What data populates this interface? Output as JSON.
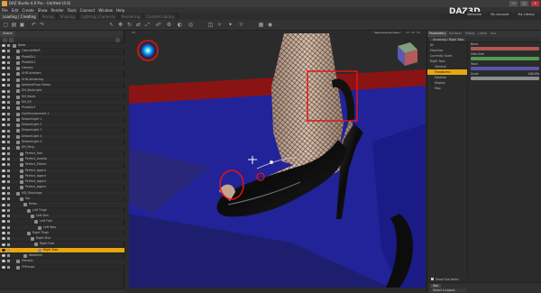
{
  "window": {
    "title": "DAZ Studio 4.6 Pro - Untitled (4.6)",
    "buttons": [
      "—",
      "□",
      "✕"
    ]
  },
  "menu": [
    "File",
    "Edit",
    "Create",
    "Show",
    "Render",
    "Tools",
    "Connect",
    "Window",
    "Help"
  ],
  "brand": {
    "logo_text": "DAZ",
    "logo_suffix": "3D",
    "account_links": [
      "Welcome",
      "My Account",
      "My Library"
    ]
  },
  "workspace_tabs": [
    {
      "label": "Loading | Creating",
      "active": true
    },
    {
      "label": "Posing",
      "active": false
    },
    {
      "label": "Shaping",
      "active": false
    },
    {
      "label": "Lighting | Cameras",
      "active": false
    },
    {
      "label": "Rendering",
      "active": false
    },
    {
      "label": "Content Library",
      "active": false
    }
  ],
  "left_panel": {
    "tabs": [
      "Scene"
    ],
    "tree": [
      {
        "label": "Node",
        "indent": 0,
        "selected": false
      },
      {
        "label": "CapsuleMinR",
        "indent": 1,
        "selected": false
      },
      {
        "label": "PhotoDL1",
        "indent": 1,
        "selected": false
      },
      {
        "label": "PhotoDL2",
        "indent": 1,
        "selected": false
      },
      {
        "label": "Camera",
        "indent": 1,
        "selected": false
      },
      {
        "label": "UHD-Ambient",
        "indent": 1,
        "selected": false
      },
      {
        "label": "UHD-Aerobring",
        "indent": 1,
        "selected": false
      },
      {
        "label": "AmbientFloor Dome",
        "indent": 1,
        "selected": false
      },
      {
        "label": "DH_BackLight",
        "indent": 1,
        "selected": false
      },
      {
        "label": "DH_BackL",
        "indent": 1,
        "selected": false
      },
      {
        "label": "DH_Fill",
        "indent": 1,
        "selected": false
      },
      {
        "label": "PhotoDL3",
        "indent": 1,
        "selected": false
      },
      {
        "label": "UserEnvironment 1",
        "indent": 1,
        "selected": false
      },
      {
        "label": "DistantLight 1",
        "indent": 1,
        "selected": false
      },
      {
        "label": "DistantLight 2",
        "indent": 1,
        "selected": false
      },
      {
        "label": "DistantLight 3",
        "indent": 1,
        "selected": false
      },
      {
        "label": "DistantLight 4",
        "indent": 1,
        "selected": false
      },
      {
        "label": "DistantLight 5",
        "indent": 1,
        "selected": false
      },
      {
        "label": "DH_Ring",
        "indent": 1,
        "selected": false
      },
      {
        "label": "Perfect_Hair",
        "indent": 2,
        "selected": false
      },
      {
        "label": "Perfect_Aurelia",
        "indent": 2,
        "selected": false
      },
      {
        "label": "Perfect_Eillene",
        "indent": 2,
        "selected": false
      },
      {
        "label": "Perfect_Isgard",
        "indent": 2,
        "selected": false
      },
      {
        "label": "Perfect_Isgard",
        "indent": 2,
        "selected": false
      },
      {
        "label": "Perfect_Isgard",
        "indent": 2,
        "selected": false
      },
      {
        "label": "Perfect_Isgard",
        "indent": 2,
        "selected": false
      },
      {
        "label": "ViD_Stockings",
        "indent": 1,
        "selected": false
      },
      {
        "label": "Hip",
        "indent": 2,
        "selected": false
      },
      {
        "label": "Pelvis",
        "indent": 3,
        "selected": false
      },
      {
        "label": "Left Thigh",
        "indent": 4,
        "selected": false
      },
      {
        "label": "Left Shin",
        "indent": 5,
        "selected": false
      },
      {
        "label": "Left Foot",
        "indent": 6,
        "selected": false
      },
      {
        "label": "Left Toes",
        "indent": 7,
        "selected": false
      },
      {
        "label": "Right Thigh",
        "indent": 4,
        "selected": false
      },
      {
        "label": "Right Shin",
        "indent": 5,
        "selected": false
      },
      {
        "label": "Right Foot",
        "indent": 6,
        "selected": false
      },
      {
        "label": "Right Toes",
        "indent": 7,
        "selected": true
      },
      {
        "label": "Abdomen",
        "indent": 3,
        "selected": false
      },
      {
        "label": "Genesis",
        "indent": 1,
        "selected": false
      },
      {
        "label": "FFPumps",
        "indent": 1,
        "selected": false
      }
    ]
  },
  "viewport": {
    "camera_select": "Perspective View",
    "stage_colors": {
      "floor": "#1e2494",
      "red_stripe": "#8a1414",
      "backdrop": "#2b2b2b"
    }
  },
  "right_panel": {
    "tabs": [
      {
        "label": "Parameters",
        "active": true
      },
      {
        "label": "Surfaces",
        "active": false
      },
      {
        "label": "Posing",
        "active": false
      },
      {
        "label": "Lights",
        "active": false
      },
      {
        "label": "Aux",
        "active": false
      }
    ],
    "selection": "Incoming / Right Toes",
    "categories": [
      {
        "label": "All",
        "highlight": false
      },
      {
        "label": "Favorites",
        "highlight": false
      },
      {
        "label": "Currently Used",
        "highlight": false
      },
      {
        "label": "Right Toes",
        "highlight": false
      },
      {
        "label": "General",
        "highlight": false
      },
      {
        "label": "Transforms",
        "highlight": true
      },
      {
        "label": "Rotation",
        "highlight": false
      },
      {
        "label": "Display",
        "highlight": false
      },
      {
        "label": "Misc",
        "highlight": false
      }
    ],
    "properties": [
      {
        "label": "Bend",
        "value": "",
        "color": "#b35555"
      },
      {
        "label": "Side-Side",
        "value": "",
        "color": "#4e9a4e"
      },
      {
        "label": "Twist",
        "value": "",
        "color": "#5b55a8"
      },
      {
        "label": "Scale",
        "value": "100.0%",
        "color": "#8c8c8c"
      }
    ],
    "footer_checkbox": "Show Sub-Items",
    "bottom_tab": "Tool",
    "bottom_select": "Select a Layout"
  }
}
